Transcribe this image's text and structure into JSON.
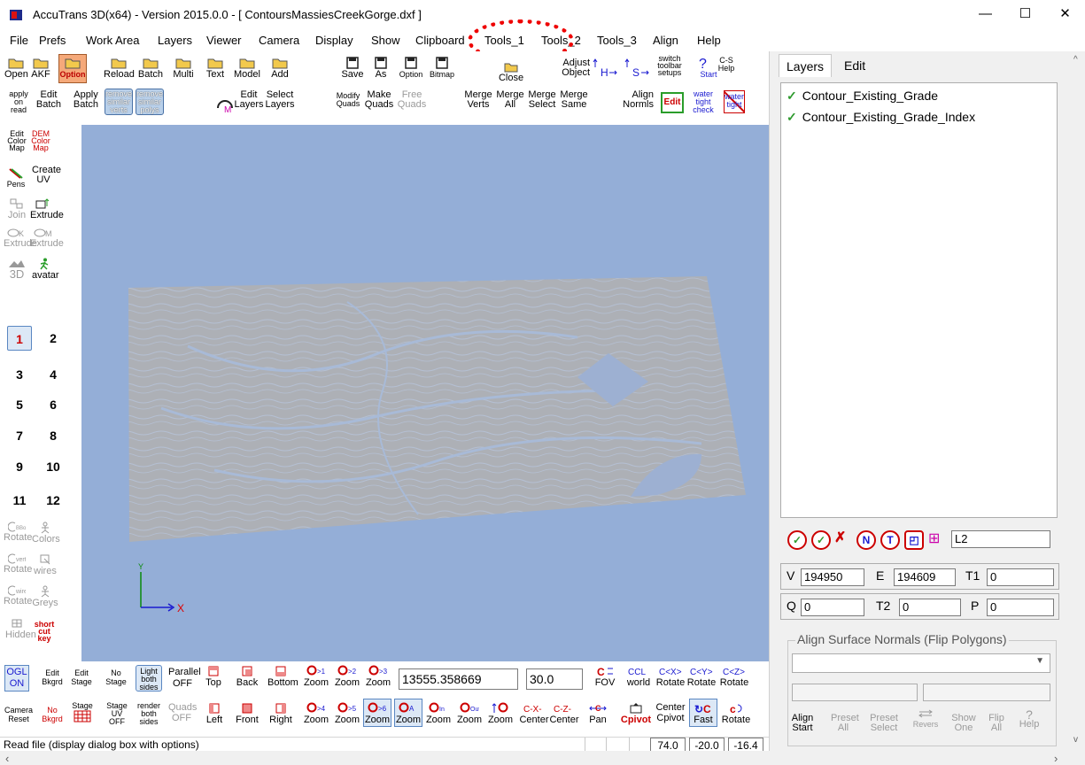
{
  "window": {
    "title": "AccuTrans 3D(x64) - Version 2015.0.0 - [ ContoursMassiesCreekGorge.dxf ]",
    "minimize": "—",
    "maximize": "☐",
    "close": "✕"
  },
  "menu": [
    "File",
    "Prefs",
    "Work Area",
    "Layers",
    "Viewer",
    "Camera",
    "Display",
    "Show",
    "Clipboard",
    "Tools_1",
    "Tools_2",
    "Tools_3",
    "Align",
    "Help"
  ],
  "toolbar": {
    "row1": [
      {
        "l1": "",
        "l2": "Open"
      },
      {
        "l1": "",
        "l2": "AKF"
      },
      {
        "l1": "",
        "l2": "Option"
      },
      {
        "l1": "",
        "l2": "Reload"
      },
      {
        "l1": "",
        "l2": "Batch"
      },
      {
        "l1": "",
        "l2": "Multi"
      },
      {
        "l1": "",
        "l2": "Text"
      },
      {
        "l1": "",
        "l2": "Model"
      },
      {
        "l1": "",
        "l2": "Add"
      },
      {
        "l1": "",
        "l2": "Save"
      },
      {
        "l1": "",
        "l2": "As"
      },
      {
        "l1": "",
        "l2": "Option"
      },
      {
        "l1": "",
        "l2": "Bitmap"
      },
      {
        "l1": "",
        "l2": "Close"
      }
    ],
    "row2": {
      "apply_on_read": "apply on read",
      "edit_batch": "Edit Batch",
      "apply_batch": "Apply Batch",
      "remove_similar_verts": "remove similar verts",
      "remove_similar_polys": "remove similar polys",
      "edit_layers": "Edit Layers",
      "select_layers": "Select Layers",
      "modify_quads": "Modify Quads",
      "make_quads": "Make Quads",
      "free_quads": "Free Quads",
      "merge_verts": "Merge Verts",
      "merge_all": "Merge All",
      "merge_select": "Merge Select",
      "merge_same": "Merge Same",
      "align_normls": "Align Normls",
      "edit": "Edit",
      "water_tight_check": "water tight check",
      "water_tight": "water tight"
    },
    "adjust_object": "Adjust Object",
    "switch_toolbar_setups": "switch toolbar setups",
    "cs_help": "C-S Help",
    "start": "Start"
  },
  "left_tools": {
    "edit_color_map": "Edit Color Map",
    "dem_color_map": "DEM Color Map",
    "pens": "Pens",
    "create_uv": "Create UV",
    "join": "Join",
    "extrude": "Extrude",
    "extrude_k": "Extrude",
    "extrude_m": "Extrude",
    "three_d": "3D",
    "avatar": "avatar",
    "numbers": [
      "1",
      "2",
      "3",
      "4",
      "5",
      "6",
      "7",
      "8",
      "9",
      "10",
      "11",
      "12"
    ],
    "bbox_rotate": "Rotate",
    "colors": "Colors",
    "verts_rotate": "Rotate",
    "wires": "wires",
    "wires_rotate": "Rotate",
    "greys": "Greys",
    "hidden": "Hidden",
    "short_cut_key": "short cut key"
  },
  "viewport": {
    "axis_x": "X",
    "axis_y": "Y"
  },
  "bottom": {
    "ogl_on": "OGL ON",
    "edit_bkgrd": "Edit Bkgrd",
    "edit_stage": "Edit Stage",
    "no_stage": "No Stage",
    "light_both_sides": "Light both sides",
    "parallel_off": "Parallel OFF",
    "top": "Top",
    "back": "Back",
    "bottom": "Bottom",
    "zoom1": "Zoom",
    "zoom2": "Zoom",
    "zoom3": "Zoom",
    "value_field": "13555.358669",
    "fov_field": "30.0",
    "fov": "FOV",
    "world": "world",
    "rotate_x": "Rotate",
    "rotate_y": "Rotate",
    "rotate_z": "Rotate",
    "camera_reset": "Camera Reset",
    "no_bkgrd": "No Bkgrd",
    "stage_grid": "Stage",
    "stage_uv_off": "Stage UV OFF",
    "render_both_sides": "render both sides",
    "quads_off": "Quads OFF",
    "left": "Left",
    "front": "Front",
    "right": "Right",
    "center_x": "Center",
    "center_z": "Center",
    "pan": "Pan",
    "cpivot": "Cpivot",
    "center_cpivot": "Center Cpivot",
    "fast": "Fast",
    "rotate": "Rotate"
  },
  "status": {
    "message": "Read file (display dialog box with options)",
    "v1": "74.0",
    "v2": "-20.0",
    "v3": "-16.4"
  },
  "right_panel": {
    "tabs": [
      "Layers",
      "Edit"
    ],
    "layers": [
      "Contour_Existing_Grade",
      "Contour_Existing_Grade_Index"
    ],
    "layer_field": "2",
    "layer_label": "L",
    "v_label": "V",
    "v_value": "194950",
    "e_label": "E",
    "e_value": "194609",
    "t1_label": "T1",
    "t1_value": "0",
    "q_label": "Q",
    "q_value": "0",
    "t2_label": "T2",
    "t2_value": "0",
    "p_label": "P",
    "p_value": "0",
    "align_group": "Align Surface Normals (Flip Polygons)",
    "align_start": "Align Start",
    "preset_all": "Preset All",
    "preset_select": "Preset Select",
    "revers": "Revers",
    "show_one": "Show One",
    "flip_all": "Flip All",
    "help": "Help"
  }
}
